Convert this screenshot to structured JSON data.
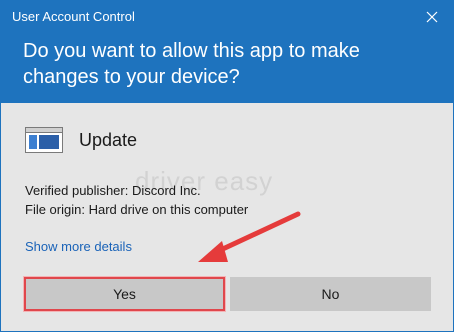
{
  "window": {
    "title": "User Account Control"
  },
  "header": {
    "question": "Do you want to allow this app to make changes to your device?"
  },
  "app": {
    "name": "Update",
    "icon": "window-app-icon"
  },
  "details": {
    "publisher": "Verified publisher: Discord Inc.",
    "origin": "File origin: Hard drive on this computer"
  },
  "watermark": "driver easy",
  "links": {
    "show_more": "Show more details"
  },
  "buttons": {
    "yes": "Yes",
    "no": "No"
  },
  "colors": {
    "header": "#1e73be",
    "body": "#e6e6e6",
    "button": "#c8c8c8",
    "highlight": "#e0474c",
    "link": "#1a63b8"
  }
}
